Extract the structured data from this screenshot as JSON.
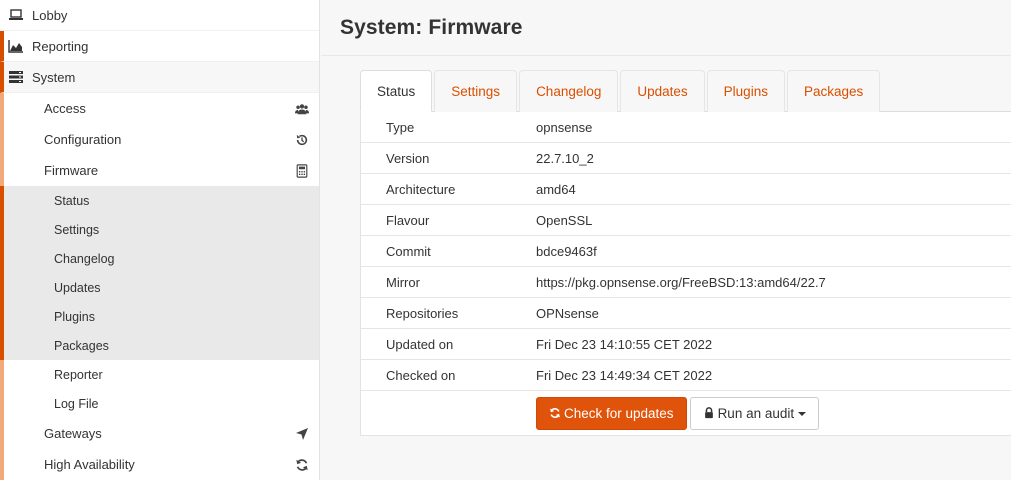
{
  "sidebar": {
    "lobby": {
      "label": "Lobby",
      "icon": "laptop-icon"
    },
    "reporting": {
      "label": "Reporting",
      "icon": "area-chart-icon"
    },
    "system": {
      "label": "System",
      "icon": "server-icon"
    },
    "sub": [
      {
        "label": "Access",
        "icon": "users-icon"
      },
      {
        "label": "Configuration",
        "icon": "history-icon"
      },
      {
        "label": "Firmware",
        "icon": "calculator-icon"
      }
    ],
    "firmware_items": [
      "Status",
      "Settings",
      "Changelog",
      "Updates",
      "Plugins",
      "Packages"
    ],
    "plain_items": [
      "Reporter",
      "Log File"
    ],
    "more": [
      {
        "label": "Gateways",
        "icon": "location-arrow-icon"
      },
      {
        "label": "High Availability",
        "icon": "refresh-icon"
      }
    ]
  },
  "page": {
    "title": "System: Firmware"
  },
  "tabs": [
    "Status",
    "Settings",
    "Changelog",
    "Updates",
    "Plugins",
    "Packages"
  ],
  "info": [
    {
      "key": "Type",
      "value": "opnsense"
    },
    {
      "key": "Version",
      "value": "22.7.10_2"
    },
    {
      "key": "Architecture",
      "value": "amd64"
    },
    {
      "key": "Flavour",
      "value": "OpenSSL"
    },
    {
      "key": "Commit",
      "value": "bdce9463f"
    },
    {
      "key": "Mirror",
      "value": "https://pkg.opnsense.org/FreeBSD:13:amd64/22.7"
    },
    {
      "key": "Repositories",
      "value": "OPNsense"
    },
    {
      "key": "Updated on",
      "value": "Fri Dec 23 14:10:55 CET 2022"
    },
    {
      "key": "Checked on",
      "value": "Fri Dec 23 14:49:34 CET 2022"
    }
  ],
  "actions": {
    "check": "Check for updates",
    "audit": "Run an audit"
  },
  "colors": {
    "accent": "#d94f00",
    "accent_light": "#f2a97a"
  }
}
